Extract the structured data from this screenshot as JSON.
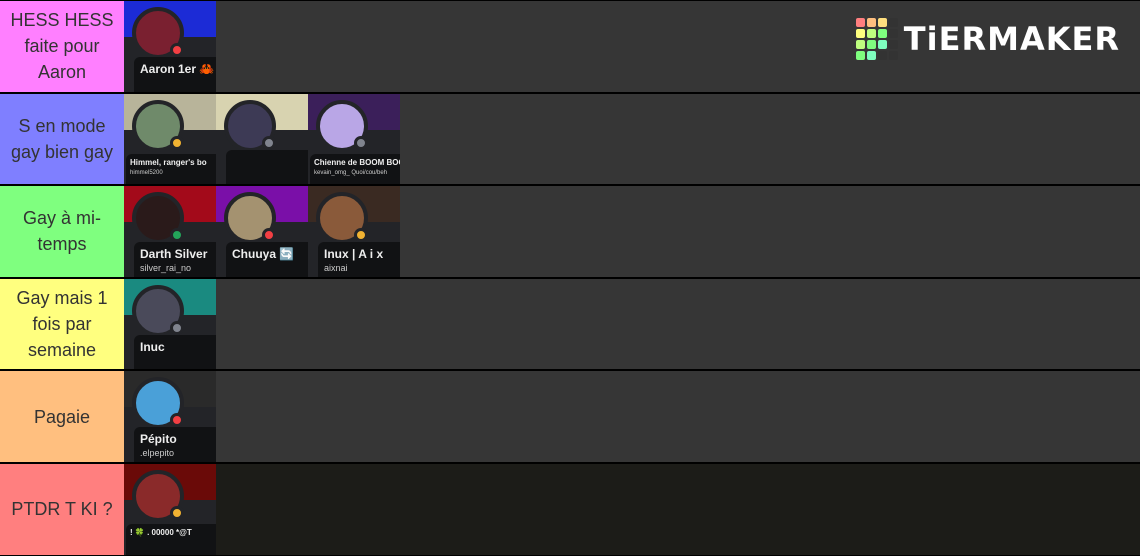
{
  "logo": {
    "text": "TiERMAKER",
    "colors": [
      "#ff7f7f",
      "#ffbf7f",
      "#ffdf7f",
      "#ffff7f",
      "#bfff7f",
      "#7fff7f",
      "#7fffbf",
      "#333"
    ]
  },
  "tiers": [
    {
      "label": "HESS HESS faite pour Aaron",
      "color": "#ff7fff",
      "items": [
        {
          "name": "Aaron 1er 🦀 CRAB",
          "banner": "#1c2bd6",
          "avatar": "#7a2030",
          "status": "dnd"
        }
      ]
    },
    {
      "label": "S en mode gay bien gay",
      "color": "#7f7fff",
      "items": [
        {
          "name": "Himmel, ranger's bo",
          "sub": "himmel5200",
          "banner": "#b8b49a",
          "avatar": "#6f8a6a",
          "status": "idle",
          "small": true
        },
        {
          "name": "",
          "banner": "#d8d3b0",
          "avatar": "#3d3a55",
          "status": "offline"
        },
        {
          "name": "Chienne de BOOM BOO",
          "sub": "kevain_omg_ Quoi/cou/beh",
          "banner": "#3b1f5a",
          "avatar": "#b9a6e6",
          "status": "offline",
          "small": true
        }
      ]
    },
    {
      "label": "Gay à mi-temps",
      "color": "#7fff7f",
      "items": [
        {
          "name": "Darth Silver",
          "sub": "silver_rai_no",
          "banner": "#a30a1a",
          "avatar": "#2a1a1a",
          "status": "online"
        },
        {
          "name": "Chuuya 🔄",
          "banner": "#7a0fa8",
          "avatar": "#a49270",
          "status": "dnd"
        },
        {
          "name": "Inux | A i x",
          "sub": "aixnai",
          "banner": "#3a2a22",
          "avatar": "#8a5a3a",
          "status": "idle"
        }
      ]
    },
    {
      "label": "Gay mais 1 fois par semaine",
      "color": "#ffff7f",
      "items": [
        {
          "name": "Inuc",
          "banner": "#1a8a80",
          "avatar": "#4a4a5a",
          "status": "offline"
        }
      ]
    },
    {
      "label": "Pagaie",
      "color": "#ffbf7f",
      "items": [
        {
          "name": "Pépito",
          "sub": ".elpepito",
          "banner": "#2a2a2a",
          "avatar": "#4aa0d8",
          "status": "dnd"
        }
      ]
    },
    {
      "label": "PTDR T KI ?",
      "color": "#ff7f7f",
      "items": [
        {
          "name": "! 🍀 . 00000 *@T",
          "banner": "#6a0a08",
          "avatar": "#8a2a2a",
          "status": "idle",
          "small": true
        }
      ]
    }
  ]
}
